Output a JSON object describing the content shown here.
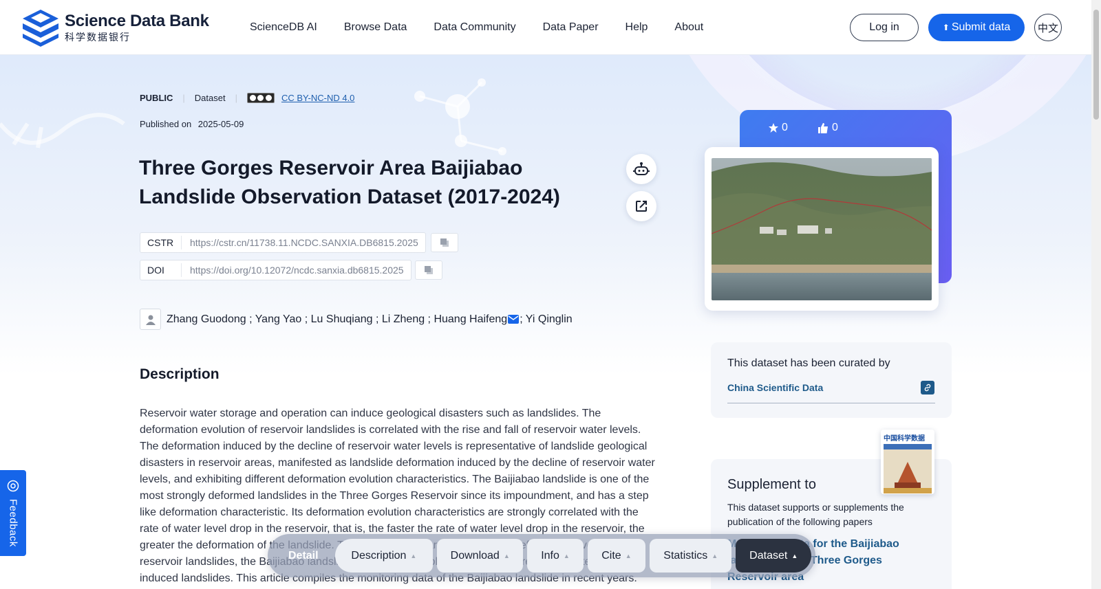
{
  "header": {
    "logo_en": "Science Data Bank",
    "logo_zh": "科学数据银行",
    "nav": [
      "ScienceDB AI",
      "Browse Data",
      "Data Community",
      "Data Paper",
      "Help",
      "About"
    ],
    "login_label": "Log in",
    "submit_label": "Submit data",
    "lang_label": "中文"
  },
  "dataset": {
    "visibility": "PUBLIC",
    "type": "Dataset",
    "license": "CC BY-NC-ND 4.0",
    "published_label": "Published on",
    "published_date": "2025-05-09",
    "title": "Three Gorges Reservoir Area Baijiabao Landslide Observation Dataset (2017-2024)",
    "cstr_label": "CSTR",
    "cstr_value": "https://cstr.cn/11738.11.NCDC.SANXIA.DB6815.2025",
    "doi_label": "DOI",
    "doi_value": "https://doi.org/10.12072/ncdc.sanxia.db6815.2025",
    "authors_before_mail": "Zhang Guodong ; Yang Yao ; Lu Shuqiang ; Li Zheng ; Huang Haifeng",
    "authors_after_mail": "; Yi Qinglin"
  },
  "description": {
    "heading": "Description",
    "text": "Reservoir water storage and operation can induce geological disasters such as landslides. The deformation evolution of reservoir landslides is correlated with the rise and fall of reservoir water levels. The deformation induced by the decline of reservoir water levels is representative of landslide geological disasters in reservoir areas, manifested as landslide deformation induced by the decline of reservoir water levels, and exhibiting different deformation evolution characteristics. The Baijiabao landslide is one of the most strongly deformed landslides in the Three Gorges Reservoir since its impoundment, and has a step like deformation characteristic. Its deformation evolution characteristics are strongly correlated with the rate of water level drop in the reservoir, that is, the faster the rate of water level drop in the reservoir, the greater the deformation of the landslide. This is a typical characteristic of the deformation evolution of reservoir landslides, the Baijiabao landslide is an important object for studying reservoir water level induced landslides. This article compiles the monitoring data of the Baijiabao landslide in recent years."
  },
  "stats": {
    "stars": "0",
    "likes": "0"
  },
  "curated": {
    "title": "This dataset has been curated by",
    "org": "China Scientific Data"
  },
  "supplement": {
    "title": "Supplement to",
    "text": "This dataset supports or supplements the publication of the following papers",
    "paper": "Monitoring data for the Baijiabao landslide in the Three Gorges Reservoir area",
    "journal_name": "中国科学数据"
  },
  "tabbar": {
    "detail_label": "Detail",
    "tabs": [
      "Description",
      "Download",
      "Info",
      "Cite",
      "Statistics",
      "Dataset"
    ]
  },
  "feedback_label": "Feedback",
  "colors": {
    "primary": "#1665e9",
    "link": "#1e5a8a",
    "stats_gradient_start": "#3e7cf0",
    "stats_gradient_end": "#6a5ef2"
  }
}
